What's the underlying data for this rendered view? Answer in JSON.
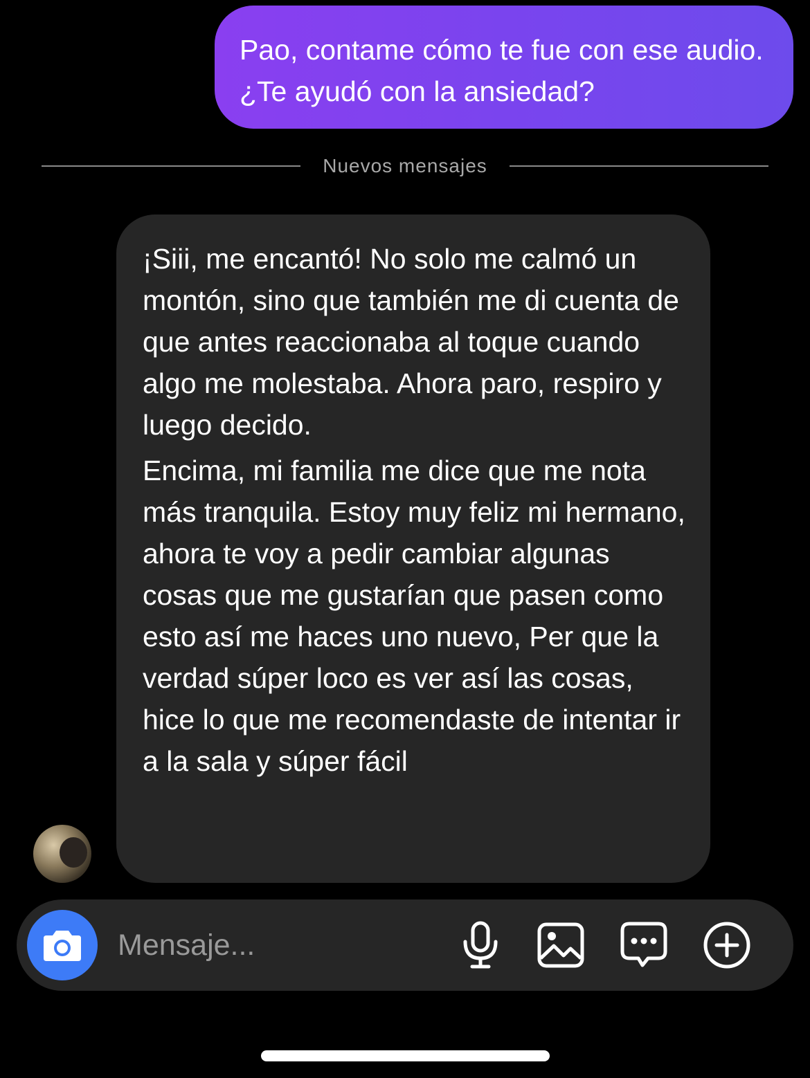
{
  "thread": {
    "outgoing_message": "Pao, contame cómo te fue con ese audio. ¿Te ayudó con la ansiedad?",
    "divider_label": "Nuevos mensajes",
    "incoming_message": {
      "paragraph_1": "¡Siii, me encantó! No solo me calmó un montón, sino que también me di cuenta de que antes reaccionaba al toque cuando algo me molestaba. Ahora paro, respiro y luego decido.",
      "paragraph_2": "Encima, mi familia me dice que me nota más tranquila. Estoy muy feliz mi hermano, ahora te voy a pedir cambiar algunas cosas que me gustarían que pasen como esto así me haces uno nuevo, Per que la verdad súper loco es ver así las cosas, hice lo que me recomendaste de intentar ir a la sala y súper fácil"
    }
  },
  "composer": {
    "placeholder": "Mensaje...",
    "icons": [
      "camera-icon",
      "microphone-icon",
      "gallery-icon",
      "sticker-chat-icon",
      "add-icon"
    ]
  },
  "colors": {
    "background": "#000000",
    "outgoing_bubble": "#7a44ee",
    "incoming_bubble": "#262626",
    "camera_button": "#3d7bf7",
    "divider": "#8a8a8a"
  }
}
